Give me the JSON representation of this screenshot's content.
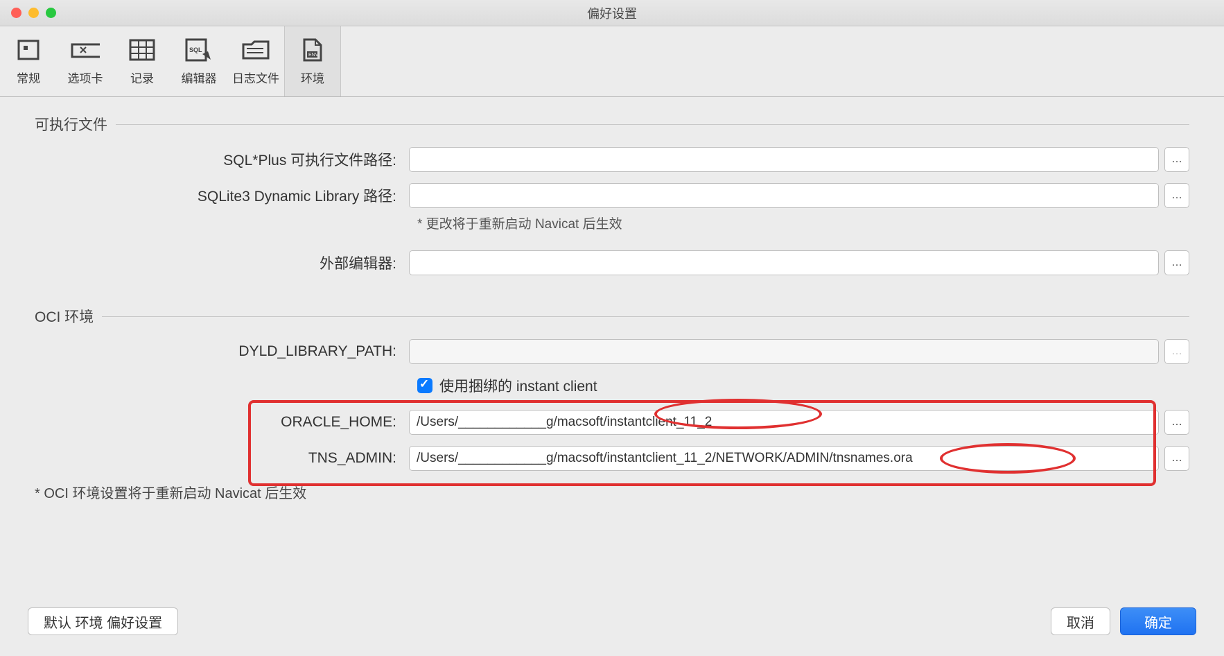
{
  "window": {
    "title": "偏好设置"
  },
  "toolbar": {
    "items": [
      {
        "label": "常规",
        "icon": "general"
      },
      {
        "label": "选项卡",
        "icon": "tabs"
      },
      {
        "label": "记录",
        "icon": "grid"
      },
      {
        "label": "编辑器",
        "icon": "sql"
      },
      {
        "label": "日志文件",
        "icon": "folder"
      },
      {
        "label": "环境",
        "icon": "env"
      }
    ],
    "active_index": 5
  },
  "sections": {
    "executables": {
      "title": "可执行文件",
      "sqlplus_label": "SQL*Plus 可执行文件路径:",
      "sqlplus_value": "",
      "sqlite_label": "SQLite3 Dynamic Library 路径:",
      "sqlite_value": "",
      "sqlite_hint": "* 更改将于重新启动 Navicat 后生效",
      "editor_label": "外部编辑器:",
      "editor_value": ""
    },
    "oci": {
      "title": "OCI 环境",
      "dyld_label": "DYLD_LIBRARY_PATH:",
      "dyld_value": "",
      "bundled_checkbox_label": "使用捆绑的 instant client",
      "bundled_checked": true,
      "oracle_home_label": "ORACLE_HOME:",
      "oracle_home_value": "/Users/____________g/macsoft/instantclient_11_2",
      "tns_admin_label": "TNS_ADMIN:",
      "tns_admin_value": "/Users/____________g/macsoft/instantclient_11_2/NETWORK/ADMIN/tnsnames.ora",
      "note": "* OCI 环境设置将于重新启动 Navicat 后生效"
    }
  },
  "footer": {
    "default_btn": "默认 环境 偏好设置",
    "cancel_btn": "取消",
    "ok_btn": "确定"
  }
}
